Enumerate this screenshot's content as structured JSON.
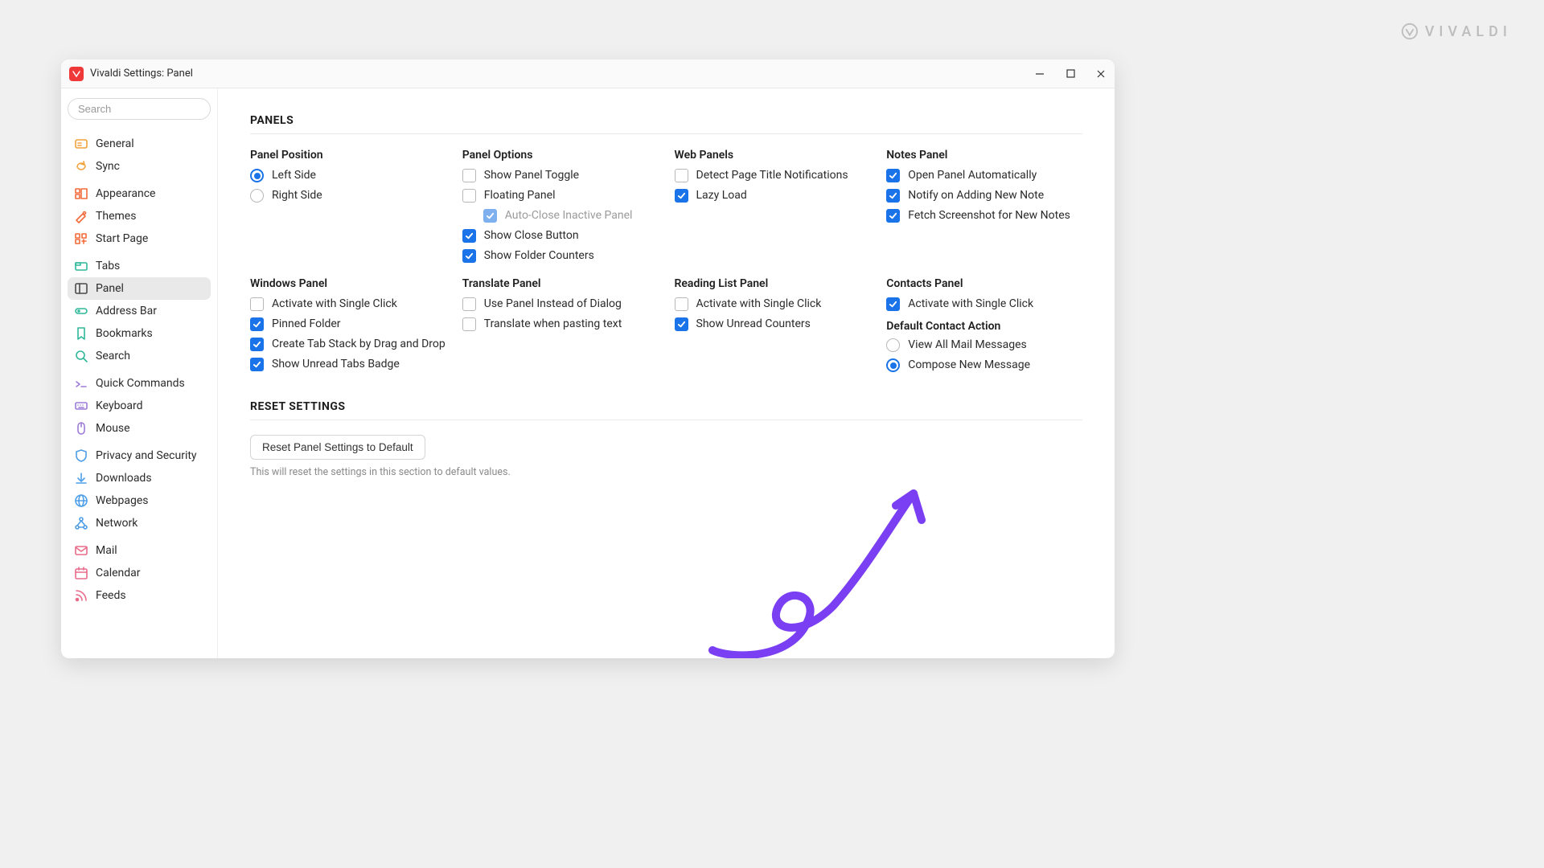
{
  "brand": "VIVALDI",
  "window": {
    "title": "Vivaldi Settings: Panel",
    "controls": {
      "min": "—",
      "max": "▢",
      "close": "✕"
    }
  },
  "search": {
    "placeholder": "Search"
  },
  "sidebar": {
    "groups": [
      [
        {
          "label": "General",
          "icon": "general",
          "color": "#f2a23a"
        },
        {
          "label": "Sync",
          "icon": "sync",
          "color": "#f2a23a"
        }
      ],
      [
        {
          "label": "Appearance",
          "icon": "appearance",
          "color": "#f26b3a"
        },
        {
          "label": "Themes",
          "icon": "themes",
          "color": "#f26b3a"
        },
        {
          "label": "Start Page",
          "icon": "startpage",
          "color": "#f26b3a"
        }
      ],
      [
        {
          "label": "Tabs",
          "icon": "tabs",
          "color": "#2fb89a"
        },
        {
          "label": "Panel",
          "icon": "panel",
          "color": "#4a4a4a",
          "active": true
        },
        {
          "label": "Address Bar",
          "icon": "address",
          "color": "#2fb89a"
        },
        {
          "label": "Bookmarks",
          "icon": "bookmarks",
          "color": "#2fb89a"
        },
        {
          "label": "Search",
          "icon": "search",
          "color": "#2fb89a"
        }
      ],
      [
        {
          "label": "Quick Commands",
          "icon": "quickcmd",
          "color": "#9d7bd8"
        },
        {
          "label": "Keyboard",
          "icon": "keyboard",
          "color": "#9d7bd8"
        },
        {
          "label": "Mouse",
          "icon": "mouse",
          "color": "#9d7bd8"
        }
      ],
      [
        {
          "label": "Privacy and Security",
          "icon": "privacy",
          "color": "#4e9fe8"
        },
        {
          "label": "Downloads",
          "icon": "downloads",
          "color": "#4e9fe8"
        },
        {
          "label": "Webpages",
          "icon": "webpages",
          "color": "#4e9fe8"
        },
        {
          "label": "Network",
          "icon": "network",
          "color": "#4e9fe8"
        }
      ],
      [
        {
          "label": "Mail",
          "icon": "mail",
          "color": "#e86b8a"
        },
        {
          "label": "Calendar",
          "icon": "calendar",
          "color": "#e86b8a"
        },
        {
          "label": "Feeds",
          "icon": "feeds",
          "color": "#e86b8a"
        }
      ]
    ]
  },
  "panels": {
    "title": "PANELS",
    "position": {
      "title": "Panel Position",
      "options": [
        {
          "label": "Left Side",
          "checked": true
        },
        {
          "label": "Right Side",
          "checked": false
        }
      ]
    },
    "options": {
      "title": "Panel Options",
      "items": [
        {
          "label": "Show Panel Toggle",
          "checked": false
        },
        {
          "label": "Floating Panel",
          "checked": false
        },
        {
          "label": "Auto-Close Inactive Panel",
          "checked": true,
          "indent": true,
          "disabled": true
        },
        {
          "label": "Show Close Button",
          "checked": true
        },
        {
          "label": "Show Folder Counters",
          "checked": true
        }
      ]
    },
    "web": {
      "title": "Web Panels",
      "items": [
        {
          "label": "Detect Page Title Notifications",
          "checked": false
        },
        {
          "label": "Lazy Load",
          "checked": true
        }
      ]
    },
    "notes": {
      "title": "Notes Panel",
      "items": [
        {
          "label": "Open Panel Automatically",
          "checked": true
        },
        {
          "label": "Notify on Adding New Note",
          "checked": true
        },
        {
          "label": "Fetch Screenshot for New Notes",
          "checked": true
        }
      ]
    },
    "windows": {
      "title": "Windows Panel",
      "items": [
        {
          "label": "Activate with Single Click",
          "checked": false
        },
        {
          "label": "Pinned Folder",
          "checked": true
        },
        {
          "label": "Create Tab Stack by Drag and Drop",
          "checked": true
        },
        {
          "label": "Show Unread Tabs Badge",
          "checked": true
        }
      ]
    },
    "translate": {
      "title": "Translate Panel",
      "items": [
        {
          "label": "Use Panel Instead of Dialog",
          "checked": false
        },
        {
          "label": "Translate when pasting text",
          "checked": false
        }
      ]
    },
    "reading": {
      "title": "Reading List Panel",
      "items": [
        {
          "label": "Activate with Single Click",
          "checked": false
        },
        {
          "label": "Show Unread Counters",
          "checked": true
        }
      ]
    },
    "contacts": {
      "title": "Contacts Panel",
      "items": [
        {
          "label": "Activate with Single Click",
          "checked": true
        }
      ],
      "defaultAction": {
        "title": "Default Contact Action",
        "options": [
          {
            "label": "View All Mail Messages",
            "checked": false
          },
          {
            "label": "Compose New Message",
            "checked": true
          }
        ]
      }
    }
  },
  "reset": {
    "title": "RESET SETTINGS",
    "button": "Reset Panel Settings to Default",
    "note": "This will reset the settings in this section to default values."
  }
}
